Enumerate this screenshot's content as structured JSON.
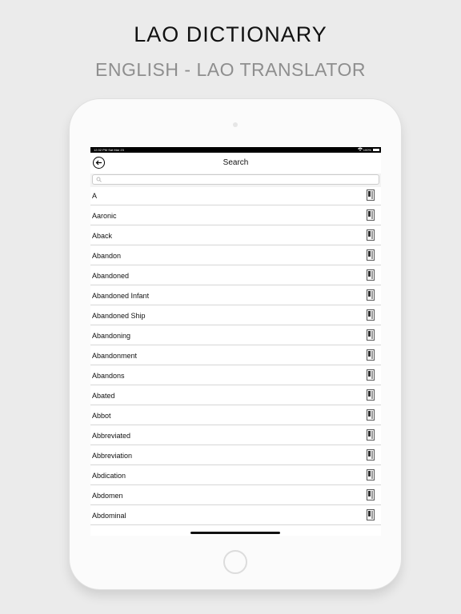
{
  "header": {
    "title": "LAO DICTIONARY",
    "subtitle": "ENGLISH - LAO TRANSLATOR"
  },
  "status_bar": {
    "time": "12:32 PM   Sat Mar 23",
    "battery": "100%"
  },
  "nav": {
    "title": "Search",
    "back_icon": "back-arrow-icon"
  },
  "search": {
    "placeholder": "",
    "value": ""
  },
  "words": [
    "A",
    "Aaronic",
    "Aback",
    "Abandon",
    "Abandoned",
    "Abandoned Infant",
    "Abandoned Ship",
    "Abandoning",
    "Abandonment",
    "Abandons",
    "Abated",
    "Abbot",
    "Abbreviated",
    "Abbreviation",
    "Abdication",
    "Abdomen",
    "Abdominal"
  ],
  "row_icon": "dictionary-book-icon"
}
